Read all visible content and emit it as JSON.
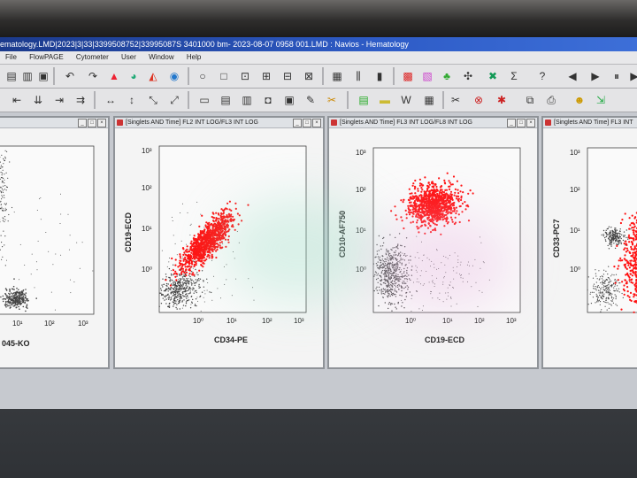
{
  "window": {
    "title": "ematology.LMD|2023|3|33|3399508752|33995087S 3401000 bm- 2023-08-07 0958 001.LMD : Navios - Hematology"
  },
  "menu": [
    "File",
    "FlowPAGE",
    "Cytometer",
    "User",
    "Window",
    "Help"
  ],
  "panels": [
    {
      "title": "",
      "x_label": "045-KO",
      "x_ticks": [
        "10¹",
        "10²",
        "10³"
      ],
      "y_label": "",
      "y_ticks": []
    },
    {
      "title": "[Singlets AND Time] FL2 INT LOG/FL3 INT LOG",
      "x_label": "CD34-PE",
      "x_ticks": [
        "10⁰",
        "10¹",
        "10²",
        "10³"
      ],
      "y_label": "CD19-ECD",
      "y_ticks": [
        "10³",
        "10²",
        "10¹",
        "10⁰"
      ]
    },
    {
      "title": "[Singlets AND Time] FL3 INT LOG/FL8 INT LOG",
      "x_label": "CD19-ECD",
      "x_ticks": [
        "10⁰",
        "10¹",
        "10²",
        "10³"
      ],
      "y_label": "CD10-AF750",
      "y_ticks": [
        "10³",
        "10²",
        "10¹",
        "10⁰"
      ]
    },
    {
      "title": "[Singlets AND Time] FL3 INT",
      "x_label": "",
      "x_ticks": [],
      "y_label": "CD33-PC7",
      "y_ticks": [
        "10³",
        "10²",
        "10¹",
        "10⁰"
      ]
    }
  ],
  "colors": {
    "gated_population": "#ff1010",
    "ungated_events": "#444444",
    "titlebar": "#2e5cc7"
  }
}
